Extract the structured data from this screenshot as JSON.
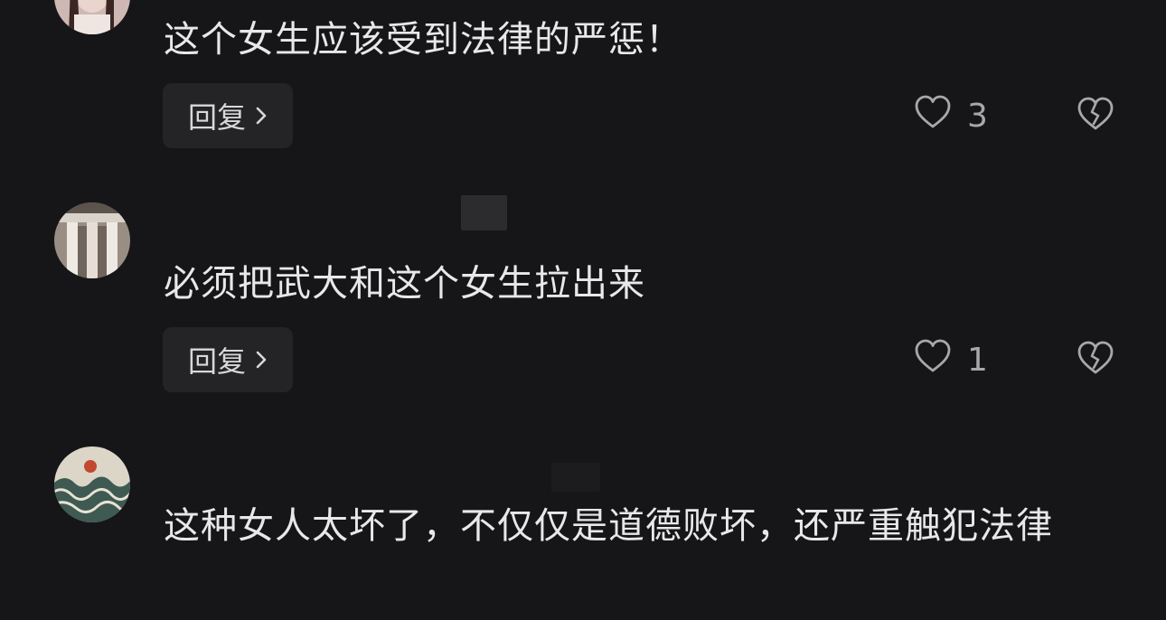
{
  "comments": [
    {
      "text": "这个女生应该受到法律的严惩！",
      "reply_label": "回复",
      "like_count": "3",
      "icons": {
        "like": "heart-outline-icon",
        "dislike": "broken-heart-icon",
        "reply": "chevron-right-icon"
      }
    },
    {
      "text": "必须把武大和这个女生拉出来",
      "reply_label": "回复",
      "like_count": "1",
      "icons": {
        "like": "heart-outline-icon",
        "dislike": "broken-heart-icon",
        "reply": "chevron-right-icon"
      }
    },
    {
      "text": "这种女人太坏了，不仅仅是道德败坏，还严重触犯法律"
    }
  ],
  "colors": {
    "background": "#161618",
    "text": "#e8e8ea",
    "reply_bg": "#242426",
    "icon": "#a8a8ac"
  }
}
